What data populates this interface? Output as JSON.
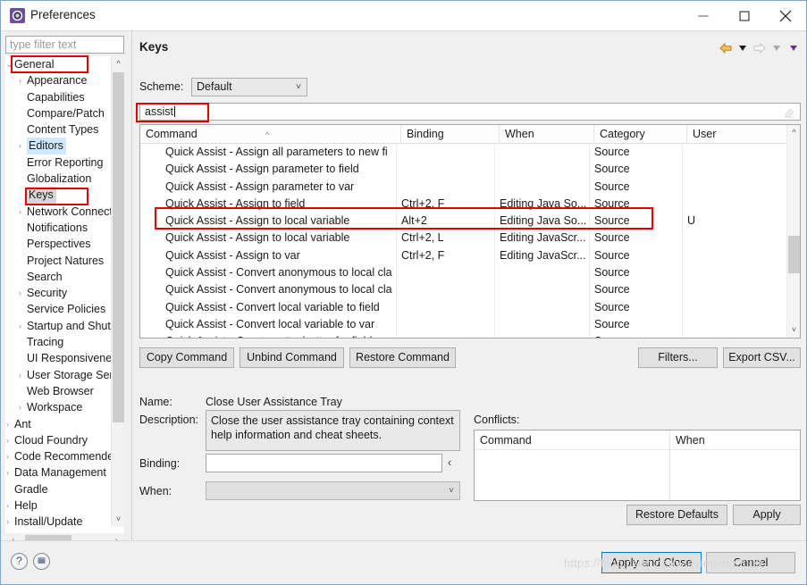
{
  "window": {
    "title": "Preferences",
    "icon": "preferences-gear-icon",
    "controls": {
      "minimize": "minimize-icon",
      "maximize": "maximize-icon",
      "close": "close-icon"
    }
  },
  "sidebar": {
    "filter_placeholder": "type filter text",
    "filter_value": "",
    "items": [
      {
        "label": "General",
        "indent": 0,
        "chevron": "down",
        "selected": "none"
      },
      {
        "label": "Appearance",
        "indent": 1,
        "chevron": "right",
        "selected": "none"
      },
      {
        "label": "Capabilities",
        "indent": 1,
        "chevron": "none",
        "selected": "none"
      },
      {
        "label": "Compare/Patch",
        "indent": 1,
        "chevron": "none",
        "selected": "none"
      },
      {
        "label": "Content Types",
        "indent": 1,
        "chevron": "none",
        "selected": "none"
      },
      {
        "label": "Editors",
        "indent": 1,
        "chevron": "right",
        "selected": "blue"
      },
      {
        "label": "Error Reporting",
        "indent": 1,
        "chevron": "none",
        "selected": "none"
      },
      {
        "label": "Globalization",
        "indent": 1,
        "chevron": "none",
        "selected": "none"
      },
      {
        "label": "Keys",
        "indent": 1,
        "chevron": "none",
        "selected": "gray"
      },
      {
        "label": "Network Connections",
        "indent": 1,
        "chevron": "right",
        "selected": "none"
      },
      {
        "label": "Notifications",
        "indent": 1,
        "chevron": "none",
        "selected": "none"
      },
      {
        "label": "Perspectives",
        "indent": 1,
        "chevron": "none",
        "selected": "none"
      },
      {
        "label": "Project Natures",
        "indent": 1,
        "chevron": "none",
        "selected": "none"
      },
      {
        "label": "Search",
        "indent": 1,
        "chevron": "none",
        "selected": "none"
      },
      {
        "label": "Security",
        "indent": 1,
        "chevron": "right",
        "selected": "none"
      },
      {
        "label": "Service Policies",
        "indent": 1,
        "chevron": "none",
        "selected": "none"
      },
      {
        "label": "Startup and Shutdown",
        "indent": 1,
        "chevron": "right",
        "selected": "none"
      },
      {
        "label": "Tracing",
        "indent": 1,
        "chevron": "none",
        "selected": "none"
      },
      {
        "label": "UI Responsiveness",
        "indent": 1,
        "chevron": "none",
        "selected": "none"
      },
      {
        "label": "User Storage Service",
        "indent": 1,
        "chevron": "right",
        "selected": "none"
      },
      {
        "label": "Web Browser",
        "indent": 1,
        "chevron": "none",
        "selected": "none"
      },
      {
        "label": "Workspace",
        "indent": 1,
        "chevron": "right",
        "selected": "none"
      },
      {
        "label": "Ant",
        "indent": 0,
        "chevron": "right",
        "selected": "none"
      },
      {
        "label": "Cloud Foundry",
        "indent": 0,
        "chevron": "right",
        "selected": "none"
      },
      {
        "label": "Code Recommenders",
        "indent": 0,
        "chevron": "right",
        "selected": "none"
      },
      {
        "label": "Data Management",
        "indent": 0,
        "chevron": "right",
        "selected": "none"
      },
      {
        "label": "Gradle",
        "indent": 0,
        "chevron": "none",
        "selected": "none"
      },
      {
        "label": "Help",
        "indent": 0,
        "chevron": "right",
        "selected": "none"
      },
      {
        "label": "Install/Update",
        "indent": 0,
        "chevron": "right",
        "selected": "none"
      }
    ]
  },
  "page": {
    "title": "Keys",
    "toolbar": [
      {
        "name": "back-arrow-icon",
        "type": "arrow-left",
        "color": "#e8a93a"
      },
      {
        "name": "back-history-caret-icon",
        "type": "caret",
        "color": "#1a1a1a"
      },
      {
        "name": "forward-arrow-icon",
        "type": "arrow-right",
        "color": "#d4d4d4"
      },
      {
        "name": "forward-history-caret-icon",
        "type": "caret",
        "color": "#a8a8a8"
      },
      {
        "name": "view-menu-caret-icon",
        "type": "caret",
        "color": "#6b2f8f"
      }
    ],
    "scheme_label": "Scheme:",
    "scheme_value": "Default",
    "search_value": "assist",
    "search_clear_icon": "eraser-icon"
  },
  "command_table": {
    "columns": [
      "Command",
      "Binding",
      "When",
      "Category",
      "User"
    ],
    "sort_column": "Command",
    "sort_direction": "ascending",
    "rows": [
      {
        "command": "Quick Assist - Assign all parameters to new fi",
        "binding": "",
        "when": "",
        "category": "Source",
        "user": "",
        "highlighted": false
      },
      {
        "command": "Quick Assist - Assign parameter to field",
        "binding": "",
        "when": "",
        "category": "Source",
        "user": "",
        "highlighted": false
      },
      {
        "command": "Quick Assist - Assign parameter to var",
        "binding": "",
        "when": "",
        "category": "Source",
        "user": "",
        "highlighted": false
      },
      {
        "command": "Quick Assist - Assign to field",
        "binding": "Ctrl+2, F",
        "when": "Editing Java So...",
        "category": "Source",
        "user": "",
        "highlighted": false
      },
      {
        "command": "Quick Assist - Assign to local variable",
        "binding": "Alt+2",
        "when": "Editing Java So...",
        "category": "Source",
        "user": "U",
        "highlighted": true
      },
      {
        "command": "Quick Assist - Assign to local variable",
        "binding": "Ctrl+2, L",
        "when": "Editing JavaScr...",
        "category": "Source",
        "user": "",
        "highlighted": false
      },
      {
        "command": "Quick Assist - Assign to var",
        "binding": "Ctrl+2, F",
        "when": "Editing JavaScr...",
        "category": "Source",
        "user": "",
        "highlighted": false
      },
      {
        "command": "Quick Assist - Convert anonymous to local cla",
        "binding": "",
        "when": "",
        "category": "Source",
        "user": "",
        "highlighted": false
      },
      {
        "command": "Quick Assist - Convert anonymous to local cla",
        "binding": "",
        "when": "",
        "category": "Source",
        "user": "",
        "highlighted": false
      },
      {
        "command": "Quick Assist - Convert local variable to field",
        "binding": "",
        "when": "",
        "category": "Source",
        "user": "",
        "highlighted": false
      },
      {
        "command": "Quick Assist - Convert local variable to var",
        "binding": "",
        "when": "",
        "category": "Source",
        "user": "",
        "highlighted": false
      },
      {
        "command": "Quick Assist - Create getter/setter for field",
        "binding": "",
        "when": "",
        "category": "Source",
        "user": "",
        "highlighted": false
      }
    ]
  },
  "action_buttons": {
    "copy_command": "Copy Command",
    "unbind_command": "Unbind Command",
    "restore_command": "Restore Command",
    "filters": "Filters...",
    "export_csv": "Export CSV..."
  },
  "details": {
    "name_label": "Name:",
    "name_value": "Close User Assistance Tray",
    "description_label": "Description:",
    "description_value": "Close the user assistance tray containing context help information and cheat sheets.",
    "binding_label": "Binding:",
    "binding_value": "",
    "binding_prev_icon": "chevron-left-icon",
    "when_label": "When:",
    "when_value": "",
    "conflicts_label": "Conflicts:",
    "conflicts_columns": [
      "Command",
      "When"
    ],
    "conflicts_rows": []
  },
  "footer": {
    "help_icon": "help-icon",
    "secondary_icon": "shell-icon",
    "restore_defaults": "Restore Defaults",
    "apply": "Apply",
    "apply_and_close": "Apply and Close",
    "cancel": "Cancel"
  },
  "watermark": "https://blog.csdn.net/yaoyingting2009",
  "colors": {
    "annotation": "#e60000",
    "default_button_border": "#0078d7",
    "tree_selection_blue": "#cde8ff",
    "tree_selection_gray": "#d6d6d6"
  }
}
